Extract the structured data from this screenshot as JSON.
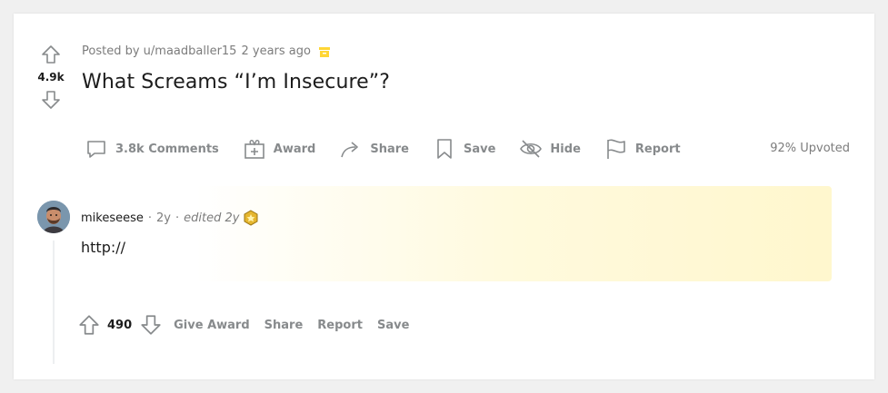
{
  "post": {
    "score": "4.9k",
    "posted_by": "Posted by u/maadballer15",
    "time_ago": "2 years ago",
    "title": "What Screams “I’m Insecure”?",
    "upvoted": "92% Upvoted",
    "actions": {
      "comments": "3.8k Comments",
      "award": "Award",
      "share": "Share",
      "save": "Save",
      "hide": "Hide",
      "report": "Report"
    }
  },
  "comment": {
    "username": "mikeseese",
    "age": "2y",
    "edited": "edited 2y",
    "body": "http://",
    "score": "490",
    "actions": {
      "give_award": "Give Award",
      "share": "Share",
      "report": "Report",
      "save": "Save"
    }
  },
  "colors": {
    "text_primary": "#1c1c1c",
    "text_muted": "#878a8c",
    "archive_badge": "#ffd635",
    "award_gold": "#e5b62f"
  },
  "icons": [
    "upvote-icon",
    "downvote-icon",
    "archive-icon",
    "comment-icon",
    "gift-icon",
    "share-icon",
    "bookmark-icon",
    "hide-eye-icon",
    "flag-icon",
    "award-icon"
  ]
}
